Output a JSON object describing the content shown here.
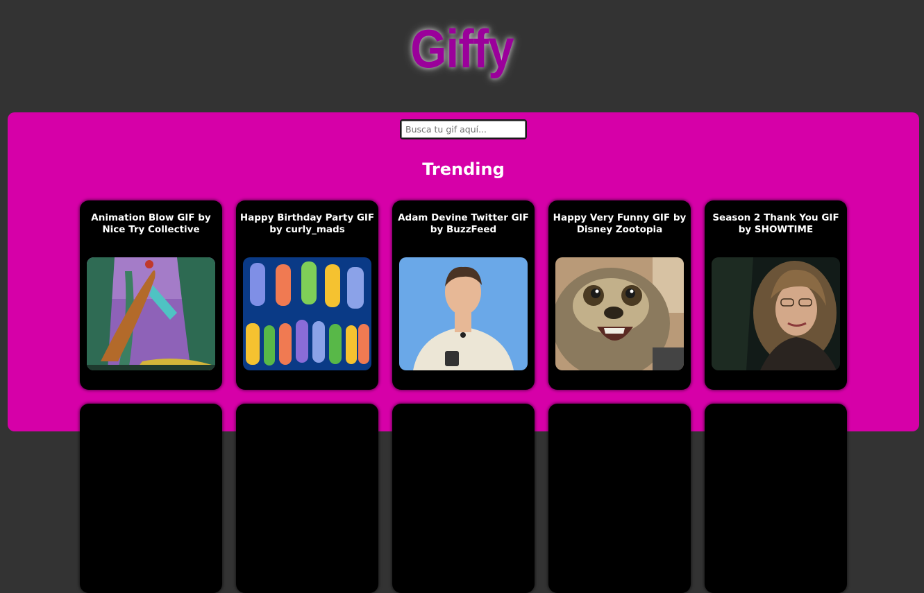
{
  "app": {
    "logo": "Giffy"
  },
  "search": {
    "placeholder": "Busca tu gif aquí..."
  },
  "trending": {
    "title": "Trending",
    "gifs": [
      {
        "title": "Animation Blow GIF by Nice Try Collective"
      },
      {
        "title": "Happy Birthday Party GIF by curly_mads"
      },
      {
        "title": "Adam Devine Twitter GIF by BuzzFeed"
      },
      {
        "title": "Happy Very Funny GIF by Disney Zootopia"
      },
      {
        "title": "Season 2 Thank You GIF by SHOWTIME"
      },
      {
        "title": ""
      },
      {
        "title": ""
      },
      {
        "title": ""
      },
      {
        "title": ""
      },
      {
        "title": ""
      }
    ]
  },
  "colors": {
    "background": "#333333",
    "panel": "#d600a8",
    "logo": "#9b009b",
    "card": "#000000"
  }
}
